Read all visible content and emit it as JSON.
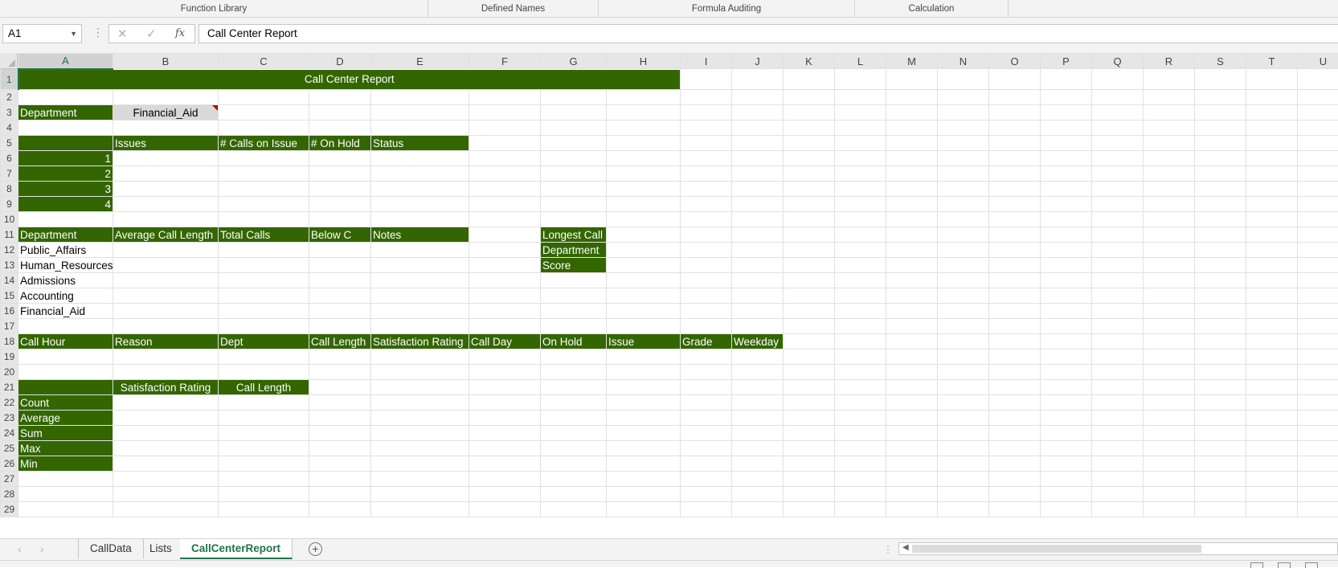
{
  "ribbon": {
    "groups": [
      "Function Library",
      "Defined Names",
      "Formula Auditing",
      "Calculation"
    ]
  },
  "formula_bar": {
    "name_box": "A1",
    "cancel_icon": "✕",
    "enter_icon": "✓",
    "fx_label": "fx",
    "content": "Call Center Report"
  },
  "columns": [
    "A",
    "B",
    "C",
    "D",
    "E",
    "F",
    "G",
    "H",
    "I",
    "J",
    "K",
    "L",
    "M",
    "N",
    "O",
    "P",
    "Q",
    "R",
    "S",
    "T",
    "U"
  ],
  "selected_column": "A",
  "selected_row": 1,
  "title": "Call Center Report",
  "dept_selector": {
    "label": "Department",
    "value": "Financial_Aid"
  },
  "issues_table": {
    "headers": [
      "",
      "Issues",
      "# Calls on Issue",
      "# On Hold",
      "Status"
    ],
    "numbers": [
      "1",
      "2",
      "3",
      "4"
    ]
  },
  "dept_table": {
    "headers": [
      "Department",
      "Average Call Length",
      "Total Calls",
      "Below C",
      "Notes"
    ],
    "departments": [
      "Public_Affairs",
      "Human_Resources",
      "Admissions",
      "Accounting",
      "Financial_Aid"
    ]
  },
  "longest_call": {
    "labels": [
      "Longest Call",
      "Department",
      "Score"
    ]
  },
  "lookup_headers": [
    "Call Hour",
    "Reason",
    "Dept",
    "Call Length",
    "Satisfaction Rating",
    "Call Day",
    "On Hold",
    "Issue",
    "Grade",
    "Weekday"
  ],
  "stats_table": {
    "headers": [
      "",
      "Satisfaction Rating",
      "Call Length"
    ],
    "rows": [
      "Count",
      "Average",
      "Sum",
      "Max",
      "Min"
    ]
  },
  "sheet_tabs": {
    "tabs": [
      "CallData",
      "Lists",
      "CallCenterReport"
    ],
    "active": "CallCenterReport",
    "add_icon": "+"
  },
  "colors": {
    "header_fill": "#336600",
    "excel_green": "#217346",
    "dropdown_fill": "#d9d9d9",
    "comment_marker": "#c00000"
  }
}
